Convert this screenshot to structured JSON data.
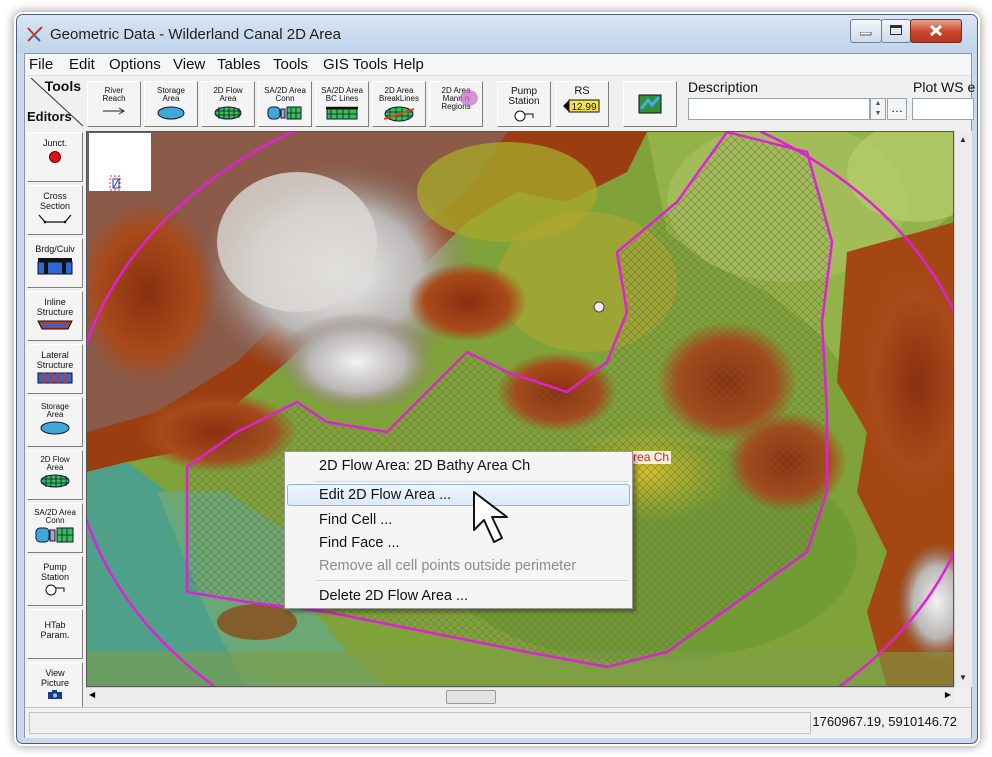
{
  "window": {
    "title": "Geometric Data - Wilderland Canal 2D Area",
    "min_icon": "minimize-icon",
    "max_icon": "maximize-icon",
    "close_icon": "close-icon"
  },
  "menubar": [
    "File",
    "Edit",
    "Options",
    "View",
    "Tables",
    "Tools",
    "GIS Tools",
    "Help"
  ],
  "toolbar": {
    "tools_label": "Tools",
    "editors_label": "Editors",
    "buttons": [
      {
        "label": "River\nReach",
        "icon": "river-reach-arrow-icon"
      },
      {
        "label": "Storage\nArea",
        "icon": "storage-area-icon"
      },
      {
        "label": "2D Flow\nArea",
        "icon": "2d-flow-area-grid-icon"
      },
      {
        "label": "SA/2D Area\nConn",
        "icon": "sa-2d-connection-icon"
      },
      {
        "label": "SA/2D Area\nBC Lines",
        "icon": "bc-lines-icon"
      },
      {
        "label": "2D Area\nBreakLines",
        "icon": "breaklines-icon"
      },
      {
        "label": "2D Area\nMann n\nRegions",
        "icon": "manning-regions-icon"
      },
      {
        "label": "Pump\nStation",
        "icon": "pump-station-icon"
      },
      {
        "label": "RS",
        "icon": "river-station-icon",
        "value": "12.99"
      },
      {
        "label": "",
        "icon": "map-picture-icon"
      }
    ],
    "description_label": "Description",
    "description_value": "",
    "plot_ws_label": "Plot WS e"
  },
  "sidebar": [
    {
      "label": "Junct.",
      "icon": "junction-red-dot-icon"
    },
    {
      "label": "Cross\nSection",
      "icon": "cross-section-icon"
    },
    {
      "label": "Brdg/Culv",
      "icon": "bridge-culvert-icon"
    },
    {
      "label": "Inline\nStructure",
      "icon": "inline-structure-icon"
    },
    {
      "label": "Lateral\nStructure",
      "icon": "lateral-structure-icon"
    },
    {
      "label": "Storage\nArea",
      "icon": "storage-area-icon"
    },
    {
      "label": "2D Flow\nArea",
      "icon": "2d-flow-area-grid-icon"
    },
    {
      "label": "SA/2D Area\nConn",
      "icon": "sa-2d-connection-icon"
    },
    {
      "label": "Pump\nStation",
      "icon": "pump-station-icon"
    },
    {
      "label": "HTab\nParam.",
      "icon": ""
    },
    {
      "label": "View\nPicture",
      "icon": "camera-icon"
    }
  ],
  "map": {
    "flow_area_label": "2D Bathy Area Ch",
    "perimeter_color": "#e020d8",
    "label_color": "#e0201f"
  },
  "context_menu": {
    "header": "2D Flow Area: 2D Bathy Area Ch",
    "items": [
      {
        "label": "Edit 2D Flow Area ...",
        "highlighted": true
      },
      {
        "label": "Find Cell ..."
      },
      {
        "label": "Find Face ..."
      },
      {
        "label": "Remove all cell points outside perimeter",
        "disabled": true
      },
      {
        "label": "Delete 2D Flow Area ..."
      }
    ]
  },
  "status": {
    "coordinates": "1760967.19, 5910146.72"
  }
}
